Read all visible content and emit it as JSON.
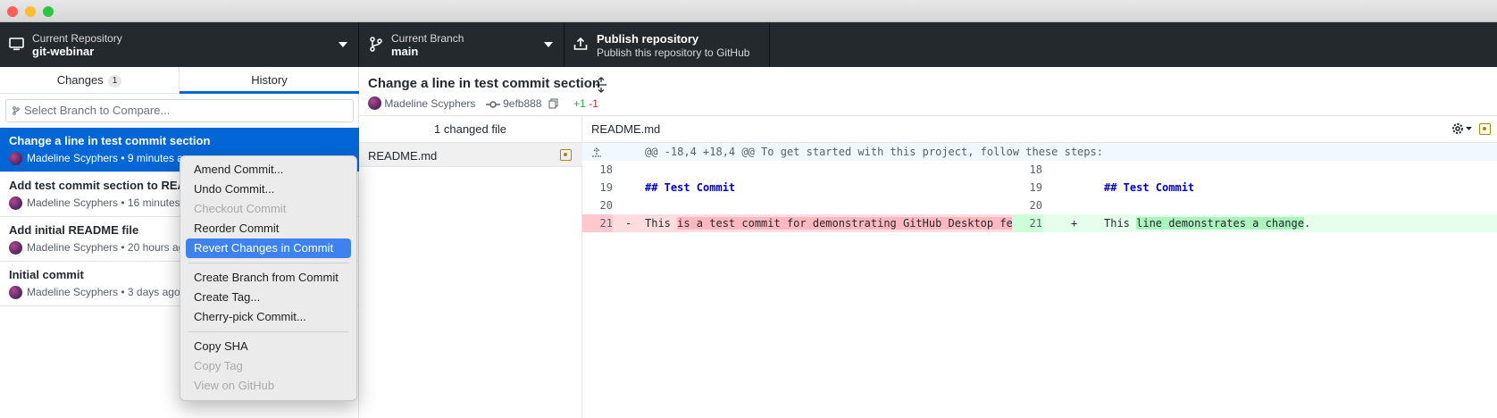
{
  "toolbar": {
    "repo": {
      "label": "Current Repository",
      "value": "git-webinar"
    },
    "branch": {
      "label": "Current Branch",
      "value": "main"
    },
    "publish": {
      "label": "Publish repository",
      "value": "Publish this repository to GitHub"
    }
  },
  "sidebar": {
    "tabs": [
      {
        "label": "Changes",
        "count": "1"
      },
      {
        "label": "History"
      }
    ],
    "compare_placeholder": "Select Branch to Compare...",
    "commits": [
      {
        "title": "Change a line in test commit section",
        "meta": "Madeline Scyphers • 9 minutes ago"
      },
      {
        "title": "Add test commit section to README",
        "meta": "Madeline Scyphers • 16 minutes ago"
      },
      {
        "title": "Add initial README file",
        "meta": "Madeline Scyphers • 20 hours ago"
      },
      {
        "title": "Initial commit",
        "meta": "Madeline Scyphers • 3 days ago"
      }
    ]
  },
  "commit_detail": {
    "title": "Change a line in test commit section",
    "author": "Madeline Scyphers",
    "sha": "9efb888",
    "added": "+1",
    "removed": "-1",
    "changed_files_label": "1 changed file",
    "file": "README.md"
  },
  "diff": {
    "file": "README.md",
    "hunk": "@@ -18,4 +18,4 @@ To get started with this project, follow these steps:",
    "lines": [
      {
        "old": "18",
        "new": "18",
        "left": "",
        "right": ""
      },
      {
        "old": "19",
        "new": "19",
        "left": "## Test Commit",
        "right": "## Test Commit"
      },
      {
        "old": "20",
        "new": "20",
        "left": "",
        "right": ""
      }
    ],
    "del": {
      "num": "21",
      "sign": "-",
      "pre": "This ",
      "mark": "is a test commit for demonstrating GitHub Desktop features",
      "post": "."
    },
    "add": {
      "num": "21",
      "sign": "+",
      "pre": "This ",
      "mark": "line demonstrates a change",
      "post": "."
    }
  },
  "context_menu": {
    "items": [
      {
        "label": "Amend Commit...",
        "state": "enabled"
      },
      {
        "label": "Undo Commit...",
        "state": "enabled"
      },
      {
        "label": "Checkout Commit",
        "state": "disabled"
      },
      {
        "label": "Reorder Commit",
        "state": "enabled"
      },
      {
        "label": "Revert Changes in Commit",
        "state": "highlighted"
      },
      {
        "label": "Create Branch from Commit",
        "state": "enabled"
      },
      {
        "label": "Create Tag...",
        "state": "enabled"
      },
      {
        "label": "Cherry-pick Commit...",
        "state": "enabled"
      },
      {
        "label": "Copy SHA",
        "state": "enabled"
      },
      {
        "label": "Copy Tag",
        "state": "disabled"
      },
      {
        "label": "View on GitHub",
        "state": "disabled"
      }
    ]
  },
  "colors": {
    "accent": "#0366d6",
    "menu_highlight": "#3d82ef",
    "deleted_bg": "#ffdce0",
    "deleted_mark": "#fdb8c0",
    "added_bg": "#e6ffed",
    "added_mark": "#acf2bd"
  },
  "icons": [
    "computer-icon",
    "branch-icon",
    "upload-icon",
    "compare-branch-icon",
    "copy-icon",
    "commit-icon",
    "gear-icon",
    "expand-icon",
    "file-modified-icon"
  ]
}
